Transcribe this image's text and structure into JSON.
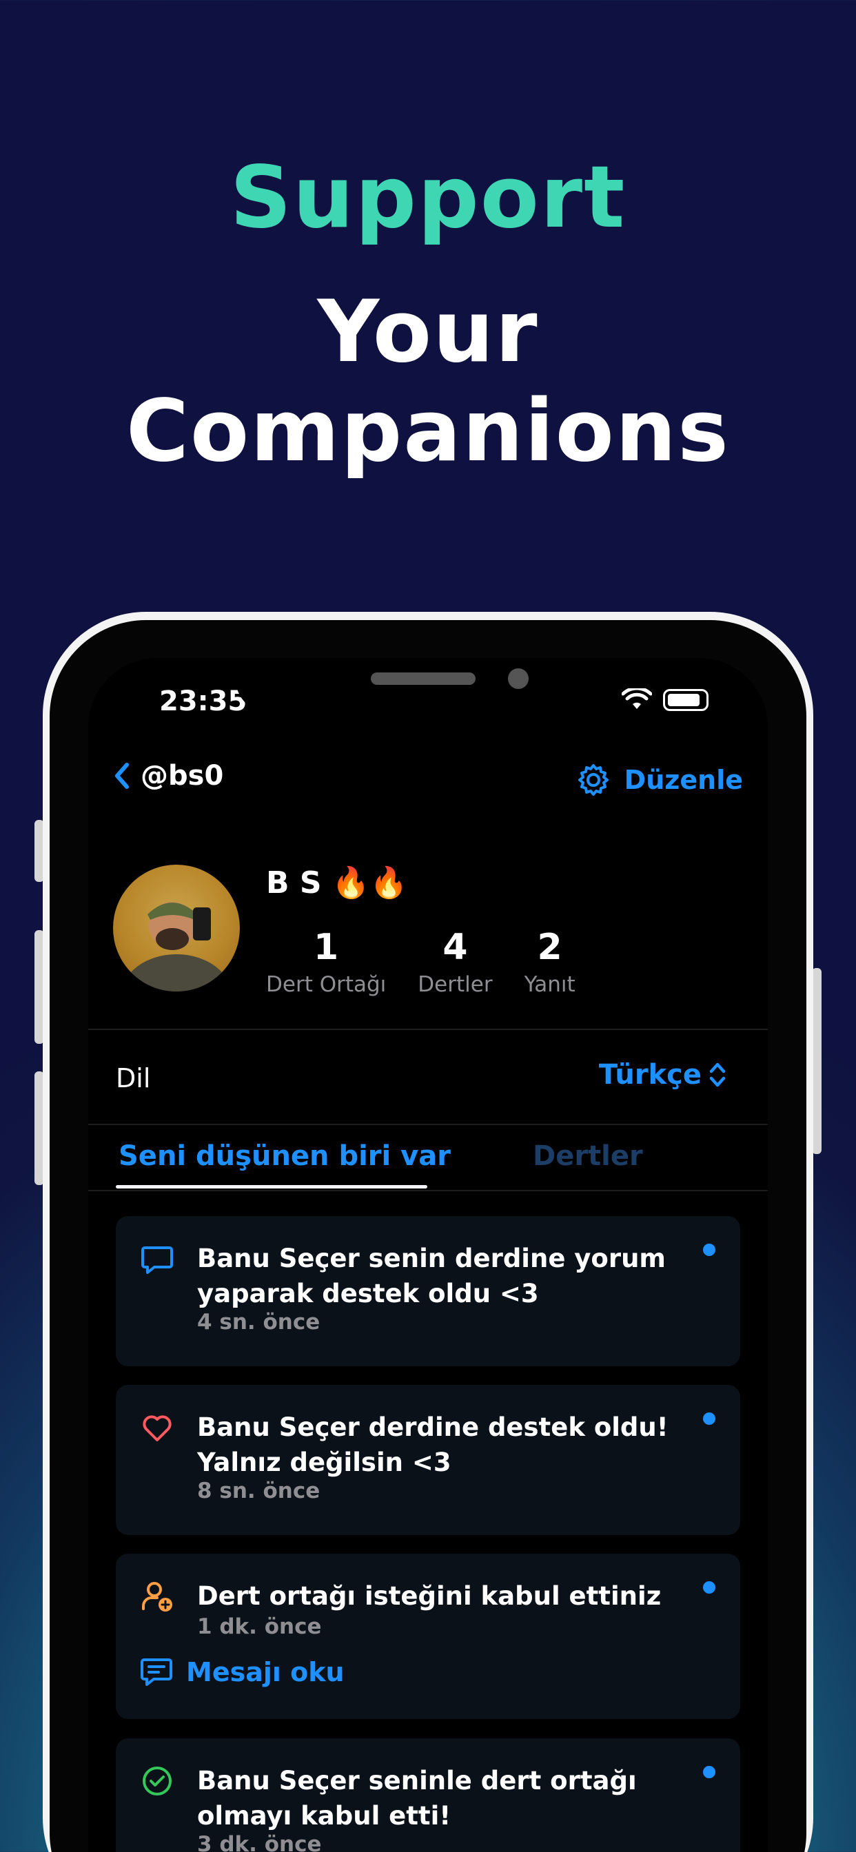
{
  "hero": {
    "line1": "Support",
    "line2": "Your Companions"
  },
  "status_bar": {
    "time": "23:35"
  },
  "nav": {
    "username": "@bs0",
    "edit_label": "Düzenle"
  },
  "profile": {
    "display_name": "B S 🔥🔥",
    "stats": [
      {
        "value": "1",
        "label": "Dert Ortağı"
      },
      {
        "value": "4",
        "label": "Dertler"
      },
      {
        "value": "2",
        "label": "Yanıt"
      }
    ]
  },
  "settings": {
    "language_label": "Dil",
    "language_value": "Türkçe"
  },
  "tabs": [
    {
      "label": "Seni düşünen biri var",
      "active": true
    },
    {
      "label": "Dertler",
      "active": false
    }
  ],
  "notifications": [
    {
      "icon": "comment-icon",
      "text": "Banu Seçer senin derdine yorum yaparak destek oldu <3",
      "time": "4 sn. önce",
      "unread": true
    },
    {
      "icon": "heart-icon",
      "text": "Banu Seçer derdine destek oldu! Yalnız değilsin <3",
      "time": "8 sn. önce",
      "unread": true
    },
    {
      "icon": "user-add-icon",
      "text": "Dert ortağı isteğini kabul ettiniz",
      "time": "1 dk. önce",
      "action": "Mesajı oku",
      "unread": true
    },
    {
      "icon": "check-circle-icon",
      "text": "Banu Seçer seninle dert ortağı olmayı kabul etti!",
      "time": "3 dk. önce",
      "unread": true
    }
  ],
  "colors": {
    "accent": "#1e90ff",
    "hero_green": "#3fd6b4",
    "heart": "#ff5a5f",
    "user_add": "#ff9f43",
    "check": "#34c759"
  }
}
